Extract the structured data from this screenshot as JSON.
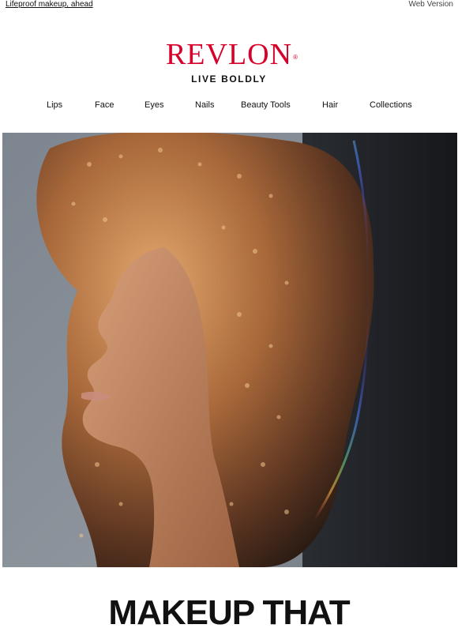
{
  "preheader": {
    "text": "Lifeproof makeup, ahead"
  },
  "web_version": {
    "label": "Web Version"
  },
  "brand": {
    "name": "REVLON",
    "registered": "®",
    "tagline": "LIVE BOLDLY",
    "color": "#d6002b"
  },
  "nav": {
    "items": [
      {
        "label": "Lips"
      },
      {
        "label": "Face"
      },
      {
        "label": "Eyes"
      },
      {
        "label": "Nails"
      },
      {
        "label": "Beauty Tools"
      },
      {
        "label": "Hair"
      },
      {
        "label": "Collections"
      }
    ]
  },
  "hero": {
    "description_icon": "hero-photo"
  },
  "headline": {
    "text": "MAKEUP THAT"
  }
}
